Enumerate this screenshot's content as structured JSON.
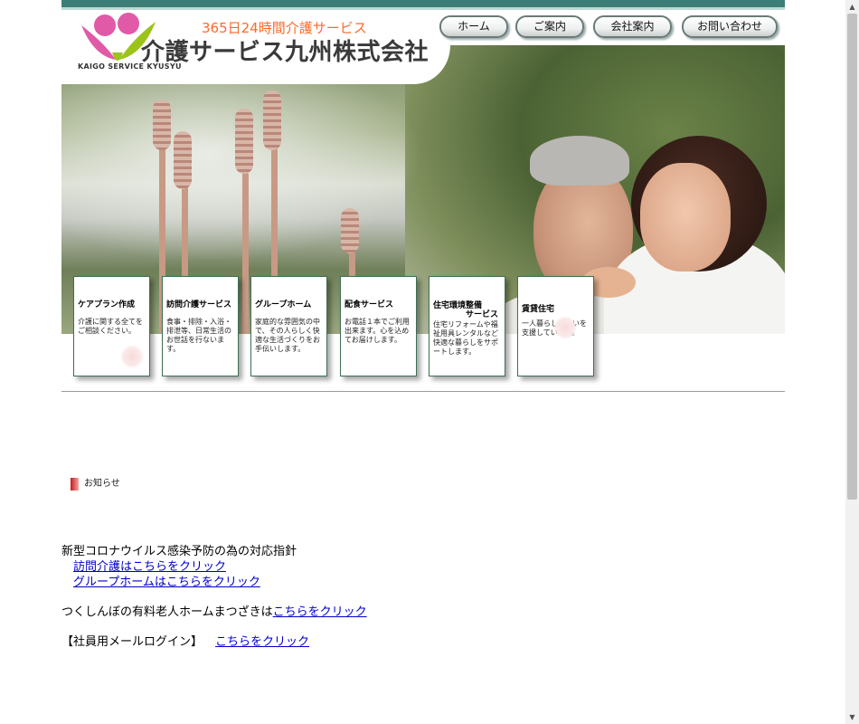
{
  "header": {
    "logo_caption": "KAIGO SERVICE KYUSYU",
    "slogan": "365日24時間介護サービス",
    "company_name": "介護サービス九州株式会社"
  },
  "nav": [
    {
      "label": "ホーム"
    },
    {
      "label": "ご案内"
    },
    {
      "label": "会社案内"
    },
    {
      "label": "お問い合わせ"
    }
  ],
  "services": [
    {
      "title": "ケアプラン作成",
      "text": "介護に関する全てをご相談ください。"
    },
    {
      "title": "訪問介護サービス",
      "text": "食事・排除・入浴・排泄等、日常生活のお世話を行ないます。"
    },
    {
      "title": "グループホーム",
      "text": "家庭的な雰囲気の中で、その人らしく快適な生活づくりをお手伝いします。"
    },
    {
      "title": "配食サービス",
      "text": "お電話１本でご利用出来ます。心を込めてお届けします。"
    },
    {
      "title_line1": "住宅環境整備",
      "title_line2": "サービス",
      "text": "住宅リフォームや福祉用具レンタルなど快適な暮らしをサポートします。"
    },
    {
      "title": "賃貸住宅",
      "text": "一人暮らし住まいを支援しています。"
    }
  ],
  "news": {
    "label": "お知らせ",
    "corona_line": "新型コロナウイルス感染予防の為の対応指針",
    "link_home_visit": "訪問介護はこちらをクリック",
    "link_group_home": "グループホームはこちらをクリック",
    "tsukushinbo_prefix": "つくしんぼの有料老人ホームまつざきは",
    "tsukushinbo_link": "こちらをクリック",
    "staff_prefix": "【社員用メールログイン】",
    "staff_link": "こちらをクリック"
  },
  "scrollbar": {
    "up_icon": "▲",
    "down_icon": "▼"
  },
  "colors": {
    "top_bar": "#3d7f77",
    "slogan": "#ff6a2a",
    "link": "#0000cc",
    "logo_pink": "#e05aa8",
    "logo_green": "#9cc31a"
  }
}
